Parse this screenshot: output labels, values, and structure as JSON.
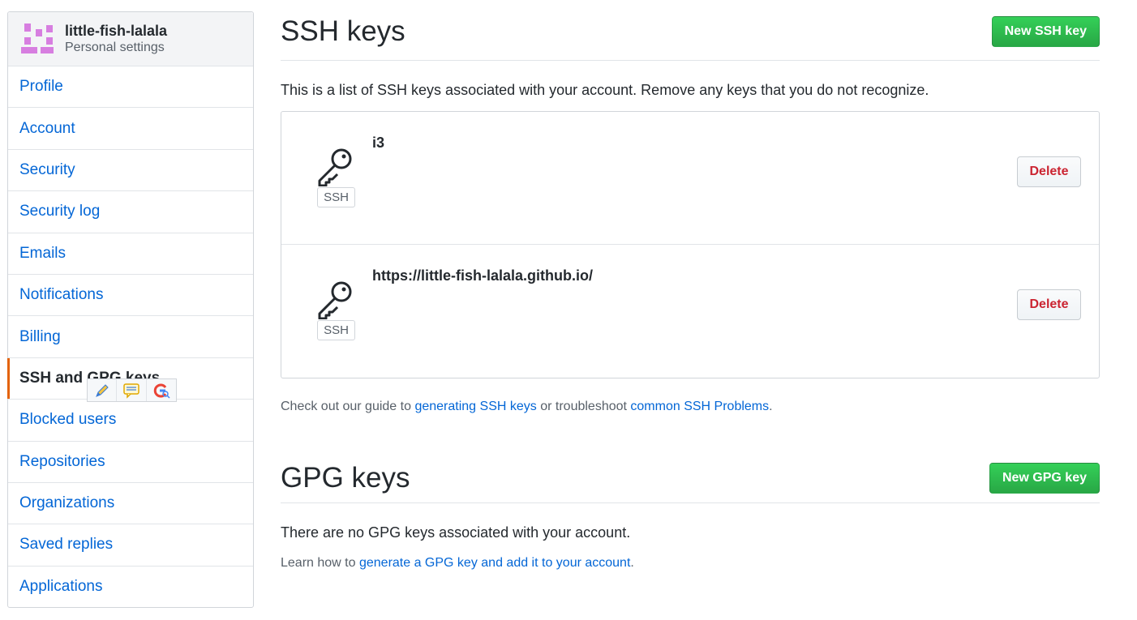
{
  "sidebar": {
    "username": "little-fish-lalala",
    "subtitle": "Personal settings",
    "items": [
      {
        "label": "Profile"
      },
      {
        "label": "Account"
      },
      {
        "label": "Security"
      },
      {
        "label": "Security log"
      },
      {
        "label": "Emails"
      },
      {
        "label": "Notifications"
      },
      {
        "label": "Billing"
      },
      {
        "label": "SSH and GPG keys",
        "selected": true
      },
      {
        "label": "Blocked users"
      },
      {
        "label": "Repositories"
      },
      {
        "label": "Organizations"
      },
      {
        "label": "Saved replies"
      },
      {
        "label": "Applications"
      }
    ]
  },
  "ssh": {
    "title": "SSH keys",
    "new_button": "New SSH key",
    "description": "This is a list of SSH keys associated with your account. Remove any keys that you do not recognize.",
    "keys": [
      {
        "title": "i3",
        "badge": "SSH",
        "delete_label": "Delete"
      },
      {
        "title": "https://little-fish-lalala.github.io/",
        "badge": "SSH",
        "delete_label": "Delete"
      }
    ],
    "guide_prefix": "Check out our guide to",
    "guide_link1": "generating SSH keys",
    "guide_middle": "or troubleshoot",
    "guide_link2": "common SSH Problems",
    "guide_suffix": "."
  },
  "gpg": {
    "title": "GPG keys",
    "new_button": "New GPG key",
    "empty_text": "There are no GPG keys associated with your account.",
    "learn_prefix": "Learn how to",
    "learn_link": "generate a GPG key and add it to your account",
    "learn_suffix": "."
  },
  "colors": {
    "link": "#0366d6",
    "green": "#28a745",
    "danger": "#cb2431",
    "selected_indicator": "#e36209",
    "avatar": "#d77ee0"
  },
  "float_toolbar": {
    "icons": [
      "pencil-icon",
      "comment-icon",
      "google-search-icon"
    ]
  }
}
